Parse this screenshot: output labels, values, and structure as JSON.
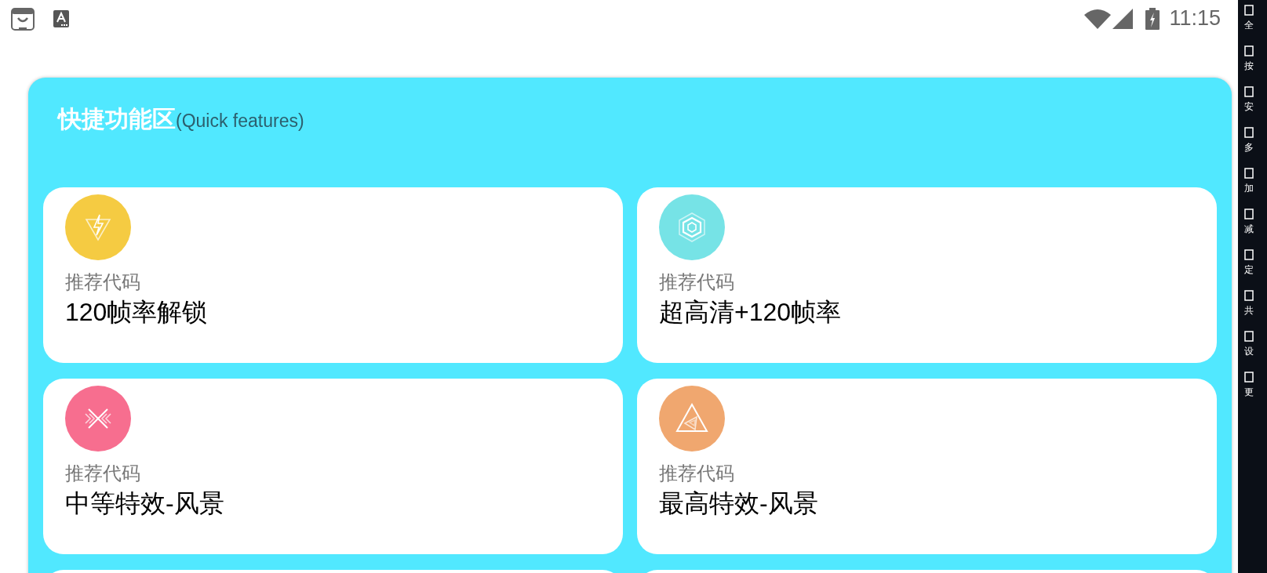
{
  "status_bar": {
    "time": "11:15"
  },
  "panel": {
    "title": "快捷功能区",
    "subtitle": "(Quick features)",
    "cards": [
      {
        "kind": "bolt",
        "color": "#f5cb42",
        "caption": "推荐代码",
        "title": "120帧率解锁"
      },
      {
        "kind": "hexagon",
        "color": "#76e3e6",
        "caption": "推荐代码",
        "title": "超高清+120帧率"
      },
      {
        "kind": "cross",
        "color": "#f76e8f",
        "caption": "推荐代码",
        "title": "中等特效-风景"
      },
      {
        "kind": "triangle",
        "color": "#f0a76f",
        "caption": "推荐代码",
        "title": "最高特效-风景"
      }
    ]
  },
  "side_strip": {
    "items": [
      {
        "label": "全"
      },
      {
        "label": "按"
      },
      {
        "label": "安"
      },
      {
        "label": "多"
      },
      {
        "label": "加"
      },
      {
        "label": "减"
      },
      {
        "label": "定"
      },
      {
        "label": "共"
      },
      {
        "label": "设"
      },
      {
        "label": "更"
      }
    ]
  }
}
